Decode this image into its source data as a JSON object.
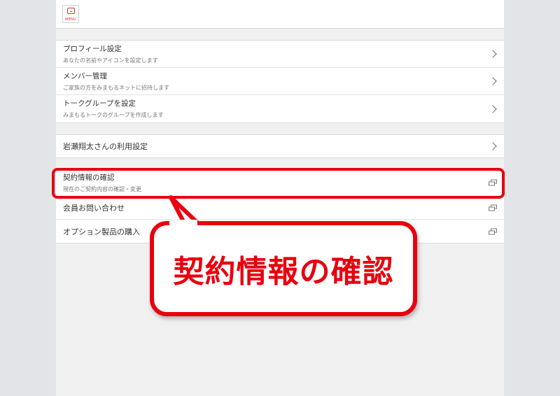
{
  "menu": {
    "label": "MENU",
    "icon": "menu-icon"
  },
  "settings_group": [
    {
      "title": "プロフィール設定",
      "subtitle": "あなたの名前やアイコンを設定します"
    },
    {
      "title": "メンバー管理",
      "subtitle": "ご家族の方をみまもるネットに招待します"
    },
    {
      "title": "トークグループを設定",
      "subtitle": "みまもるトークのグループを作成します"
    }
  ],
  "user_settings": {
    "title": "岩瀬翔太さんの利用設定"
  },
  "links_group": [
    {
      "title": "契約情報の確認",
      "subtitle": "現在のご契約内容の確認・変更"
    },
    {
      "title": "会員お問い合わせ"
    },
    {
      "title": "オプション製品の購入"
    }
  ],
  "callout": {
    "text": "契約情報の確認"
  },
  "colors": {
    "accent": "#e8000e",
    "background": "#e2e4e7",
    "panel": "#f0f0f0"
  }
}
